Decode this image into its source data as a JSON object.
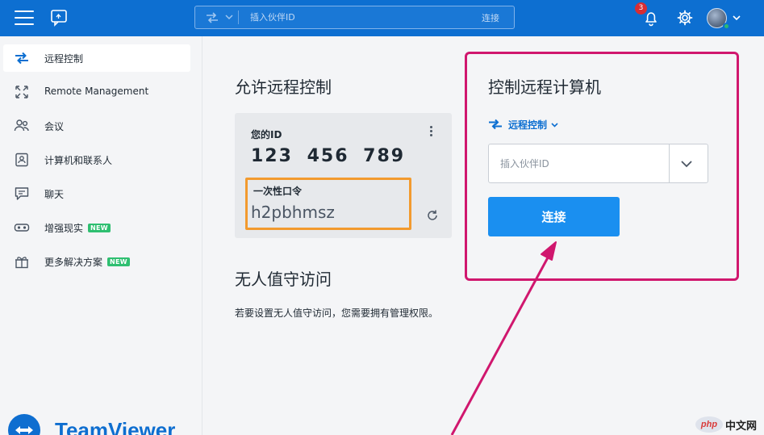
{
  "header": {
    "search_placeholder": "插入伙伴ID",
    "connect_label": "连接",
    "notification_count": "3",
    "colors": {
      "bar": "#0d6fd1",
      "badge": "#d72d34"
    }
  },
  "sidebar": {
    "items": [
      {
        "label": "远程控制",
        "icon": "arrows-swap-icon",
        "active": true,
        "new": ""
      },
      {
        "label": "Remote Management",
        "icon": "expand-icon",
        "active": false,
        "new": ""
      },
      {
        "label": "会议",
        "icon": "people-icon",
        "active": false,
        "new": ""
      },
      {
        "label": "计算机和联系人",
        "icon": "contact-card-icon",
        "active": false,
        "new": ""
      },
      {
        "label": "聊天",
        "icon": "chat-icon",
        "active": false,
        "new": ""
      },
      {
        "label": "增强现实",
        "icon": "ar-glasses-icon",
        "active": false,
        "new": "NEW"
      },
      {
        "label": "更多解决方案",
        "icon": "gift-icon",
        "active": false,
        "new": "NEW"
      }
    ],
    "logo_text": "TeamViewer"
  },
  "allow_remote": {
    "title": "允许远程控制",
    "id_label": "您的ID",
    "id_value": "123 456 789",
    "password_label": "一次性口令",
    "password_value": "h2pbhmsz"
  },
  "unattended": {
    "title": "无人值守访问",
    "description": "若要设置无人值守访问，您需要拥有管理权限。"
  },
  "control_remote": {
    "title": "控制远程计算机",
    "mode_label": "远程控制",
    "partner_placeholder": "插入伙伴ID",
    "connect_button": "连接",
    "colors": {
      "highlight_border": "#d0176e",
      "password_highlight": "#f29a2e",
      "button": "#1a8ff0"
    }
  },
  "watermark": {
    "left": "php",
    "right": "中文网"
  }
}
